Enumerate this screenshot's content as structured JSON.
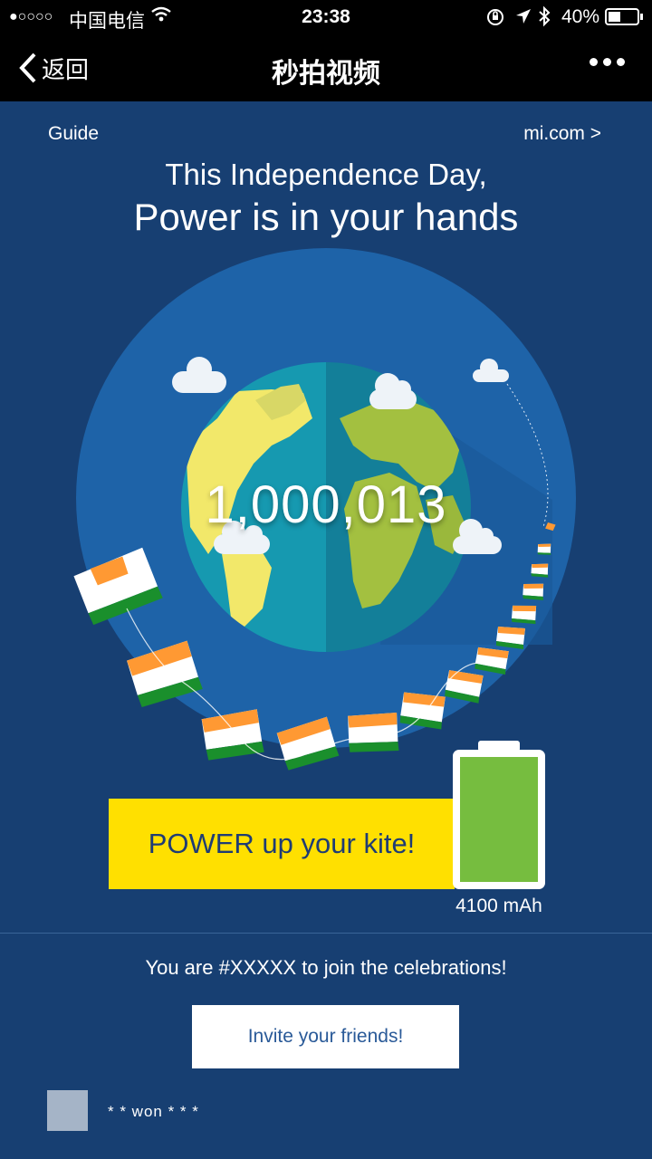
{
  "status_bar": {
    "signal": "●○○○○",
    "carrier": "中国电信",
    "time": "23:38",
    "battery_percent": "40%",
    "icons": [
      "wifi-icon",
      "orientation-lock-icon",
      "location-icon",
      "bluetooth-icon",
      "battery-icon"
    ]
  },
  "nav": {
    "back_label": "返回",
    "title": "秒拍视频",
    "more_icon": "more-dots-icon"
  },
  "page": {
    "guide": "Guide",
    "site_link": "mi.com  >",
    "hero_line1": "This Independence Day,",
    "hero_line2": "Power is in your hands",
    "counter": "1,000,013",
    "power_button": "POWER up your kite!",
    "battery_capacity": "4100 mAh",
    "battery_level": 1.0,
    "join_text": "You are #XXXXX to join the celebrations!",
    "invite_button": "Invite your friends!",
    "winner_text": "* * won * * *"
  },
  "colors": {
    "background": "#173f72",
    "globe_halo": "#1e63a8",
    "ocean": "#1792a8",
    "land": "#9fbf3e",
    "yellow_button": "#ffe000",
    "battery_fill": "#76bd3f",
    "kite_saffron": "#ff9933",
    "kite_green": "#1a8f2c"
  }
}
